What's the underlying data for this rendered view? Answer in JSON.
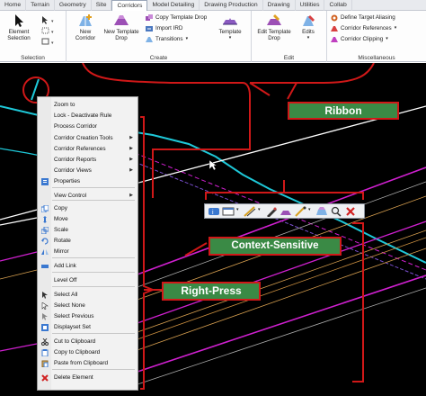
{
  "tabs": [
    "Home",
    "Terrain",
    "Geometry",
    "Site",
    "Corridors",
    "Model Detailing",
    "Drawing Production",
    "Drawing",
    "Utilities",
    "Collab"
  ],
  "active_tab": "Corridors",
  "ribbon": {
    "selection": {
      "label": "Selection",
      "element_selection": "Element Selection"
    },
    "create": {
      "label": "Create",
      "new_corridor": "New Corridor",
      "new_template_drop": "New Template Drop",
      "copy_template_drop": "Copy Template Drop",
      "import_ird": "Import IRD",
      "transitions": "Transitions",
      "template": "Template"
    },
    "edit": {
      "label": "Edit",
      "edit_template_drop": "Edit Template Drop",
      "edits": "Edits"
    },
    "misc": {
      "label": "Miscellaneous",
      "define_target_aliasing": "Define Target Aliasing",
      "corridor_references": "Corridor References",
      "corridor_clipping": "Corridor Clipping"
    }
  },
  "context_menu": [
    {
      "label": "Zoom to",
      "icon": "none",
      "submenu": false
    },
    {
      "label": "Lock - Deactivate Rule",
      "icon": "none",
      "submenu": false
    },
    {
      "label": "Process Corridor",
      "icon": "none",
      "submenu": false
    },
    {
      "label": "Corridor Creation Tools",
      "icon": "none",
      "submenu": true
    },
    {
      "label": "Corridor References",
      "icon": "none",
      "submenu": true
    },
    {
      "label": "Corridor Reports",
      "icon": "none",
      "submenu": true
    },
    {
      "label": "Corridor Views",
      "icon": "none",
      "submenu": true
    },
    {
      "label": "Properties",
      "icon": "properties-icon",
      "submenu": false
    },
    {
      "label": "View Control",
      "icon": "none",
      "submenu": true
    },
    {
      "label": "Copy",
      "icon": "copy-icon",
      "submenu": false
    },
    {
      "label": "Move",
      "icon": "move-icon",
      "submenu": false
    },
    {
      "label": "Scale",
      "icon": "scale-icon",
      "submenu": false
    },
    {
      "label": "Rotate",
      "icon": "rotate-icon",
      "submenu": false
    },
    {
      "label": "Mirror",
      "icon": "mirror-icon",
      "submenu": false
    },
    {
      "label": "Add Link",
      "icon": "add-link-icon",
      "submenu": false
    },
    {
      "label": "Level Off",
      "icon": "none",
      "submenu": false
    },
    {
      "label": "Select All",
      "icon": "select-all-icon",
      "submenu": false
    },
    {
      "label": "Select None",
      "icon": "select-none-icon",
      "submenu": false
    },
    {
      "label": "Select Previous",
      "icon": "select-previous-icon",
      "submenu": false
    },
    {
      "label": "Displayset Set",
      "icon": "displayset-icon",
      "submenu": false
    },
    {
      "label": "Cut to Clipboard",
      "icon": "cut-icon",
      "submenu": false
    },
    {
      "label": "Copy to Clipboard",
      "icon": "copy-clipboard-icon",
      "submenu": false
    },
    {
      "label": "Paste from Clipboard",
      "icon": "paste-icon",
      "submenu": false
    },
    {
      "label": "Delete Element",
      "icon": "delete-icon",
      "submenu": false
    }
  ],
  "annotations": {
    "ribbon": "Ribbon",
    "context_sensitive": "Context-Sensitive",
    "right_press": "Right-Press"
  },
  "colors": {
    "label_bg": "#3a8a45",
    "label_border": "#d01818",
    "corridor_cyan": "#1ec8d8",
    "magenta": "#d020d0",
    "orange": "#d8a050"
  }
}
